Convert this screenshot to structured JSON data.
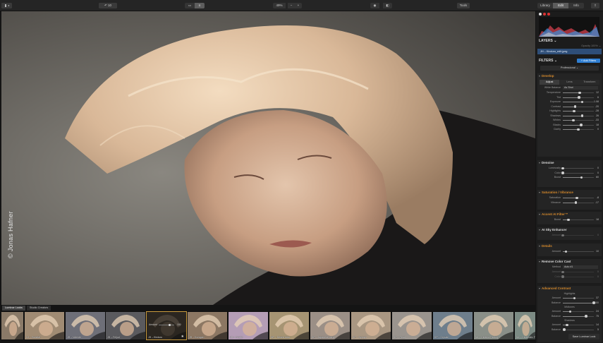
{
  "toolbar": {
    "zoom_label": "49%",
    "zoom_minus": "−",
    "zoom_plus": "+",
    "undo_count": "10",
    "tools_label": "Tools",
    "mode_tabs": [
      "Library",
      "Edit",
      "Info"
    ]
  },
  "watermark": "© Jonas Hafner",
  "panel": {
    "layers_title": "LAYERS ⌄",
    "layer_opacity": "Opacity 100% ⌄",
    "layer_name": "JH – Kinduru_edit.jpeg",
    "filters_title": "FILTERS ⌄",
    "add_filter": "+ Add Filters",
    "workspace": "Professional ⌄",
    "develop": {
      "title": "Develop",
      "tabs": [
        "Adjust",
        "Lens",
        "Transform"
      ],
      "white_balance_label": "White Balance",
      "white_balance_value": "As Shot",
      "rows": [
        {
          "label": "Temperature",
          "value": "12",
          "pos": 0.55
        },
        {
          "label": "Tint",
          "value": "6",
          "pos": 0.52
        },
        {
          "label": "Exposure",
          "value": "1.08",
          "pos": 0.62
        },
        {
          "label": "Contrast",
          "value": "-20",
          "pos": 0.4
        },
        {
          "label": "Highlights",
          "value": "-28",
          "pos": 0.36
        },
        {
          "label": "Shadows",
          "value": "26",
          "pos": 0.63
        },
        {
          "label": "Whites",
          "value": "-33",
          "pos": 0.34
        },
        {
          "label": "Blacks",
          "value": "18",
          "pos": 0.59
        },
        {
          "label": "Clarity",
          "value": "0",
          "pos": 0.5
        }
      ]
    },
    "denoise": {
      "title": "Denoise",
      "rows": [
        {
          "label": "Luminosity",
          "value": "0",
          "pos": 0.0
        },
        {
          "label": "Color",
          "value": "0",
          "pos": 0.0
        },
        {
          "label": "Boost",
          "value": "60",
          "pos": 0.6
        }
      ]
    },
    "saturation": {
      "title": "Saturation / Vibrance",
      "rows": [
        {
          "label": "Saturation",
          "value": "-8",
          "pos": 0.46
        },
        {
          "label": "Vibrance",
          "value": "-17",
          "pos": 0.42
        }
      ]
    },
    "accent_ai": {
      "title": "Accent AI Filter™",
      "rows": [
        {
          "label": "Boost",
          "value": "18",
          "pos": 0.18
        }
      ]
    },
    "ai_sky": {
      "title": "AI Sky Enhancer",
      "rows": [
        {
          "label": "Amount",
          "value": "0",
          "pos": 0.0
        }
      ]
    },
    "details": {
      "title": "Details",
      "rows": [
        {
          "label": "Amount",
          "value": "10",
          "pos": 0.1
        }
      ]
    },
    "remove_color_cast": {
      "title": "Remove Color Cast",
      "method_label": "Method",
      "method_value": "Auto #1",
      "rows": [
        {
          "label": "Amount",
          "value": "0",
          "pos": 0.0
        },
        {
          "label": "Color",
          "value": "0",
          "pos": 0.0
        }
      ]
    },
    "advanced_contrast": {
      "title": "Advanced Contrast",
      "groups": [
        {
          "name": "Highlights",
          "rows": [
            {
              "label": "Amount",
              "value": "37",
              "pos": 0.37
            },
            {
              "label": "Balance",
              "value": "100",
              "pos": 1.0
            }
          ]
        },
        {
          "name": "Midtones",
          "rows": [
            {
              "label": "Amount",
              "value": "24",
              "pos": 0.24
            },
            {
              "label": "Balance",
              "value": "75",
              "pos": 0.75
            }
          ]
        },
        {
          "name": "Shadows",
          "rows": [
            {
              "label": "Amount",
              "value": "14",
              "pos": 0.14
            },
            {
              "label": "Balance",
              "value": "5",
              "pos": 0.05
            }
          ]
        }
      ]
    },
    "save_label": "Save Luminar Look"
  },
  "bottom": {
    "tabs": [
      "Luminar Looks",
      "Studio Creators"
    ],
    "selected_amount_label": "Amount",
    "selected_amount_value": "100",
    "thumbs": [
      {
        "label": "",
        "tone": "#8a7a68"
      },
      {
        "label": "CJ – Sundial",
        "tone": "#a08b73"
      },
      {
        "label": "JH – Valente",
        "tone": "#6e6f78"
      },
      {
        "label": "JH – Feljud",
        "tone": "#5a5a5e"
      },
      {
        "label": "JH – Kinduru",
        "tone": "#2b2620"
      },
      {
        "label": "JH – Kurugan",
        "tone": "#8c7763"
      },
      {
        "label": "JH – Frozni",
        "tone": "#b49db5"
      },
      {
        "label": "NP – Desert dust",
        "tone": "#a69473"
      },
      {
        "label": "KP – Japanese berry",
        "tone": "#9b8f86"
      },
      {
        "label": "KP – Nymph",
        "tone": "#a99782"
      },
      {
        "label": "KP – Pearl",
        "tone": "#9a948e"
      },
      {
        "label": "KP – Crystal",
        "tone": "#6e7e8c"
      },
      {
        "label": "NL – Cinema Fading",
        "tone": "#8a8f88"
      },
      {
        "label": "NL – Cinematic Fx",
        "tone": "#7c8b84"
      }
    ]
  }
}
